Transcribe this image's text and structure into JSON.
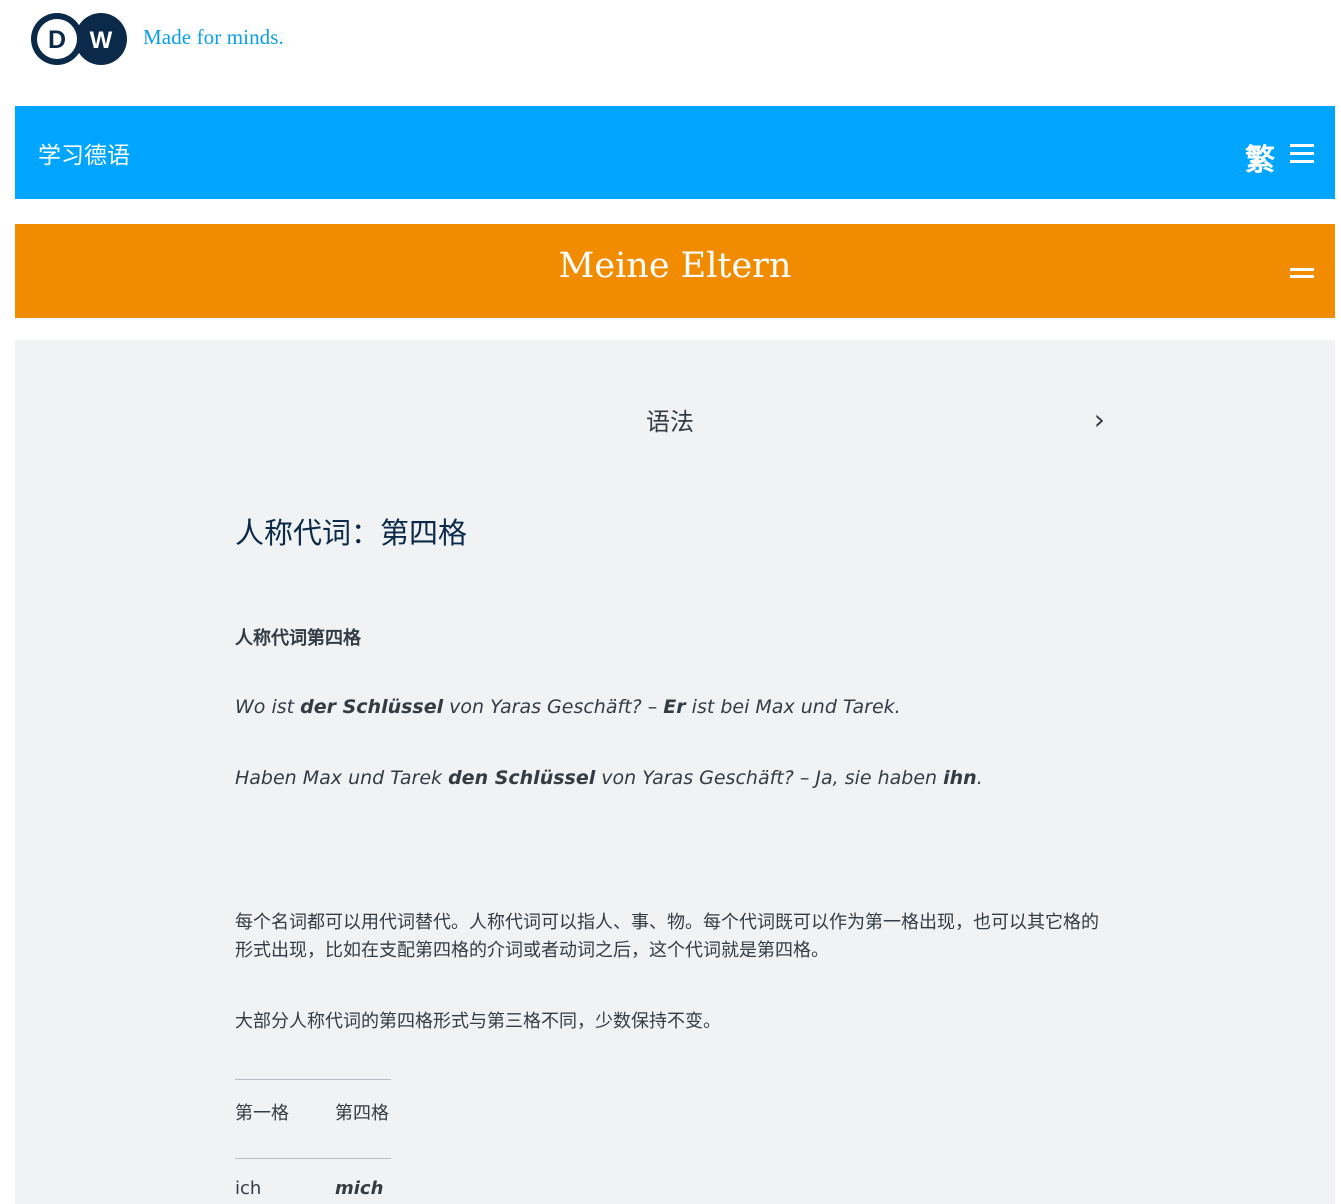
{
  "header": {
    "logo_text": "DW",
    "tagline": "Made for minds."
  },
  "navbar": {
    "title": "学习德语",
    "lang_switch": "繁"
  },
  "lesson": {
    "title": "Meine Eltern"
  },
  "section": {
    "label": "语法",
    "chevron": "›"
  },
  "article": {
    "title": "人称代词：第四格",
    "subheading": "人称代词第四格",
    "example1": {
      "p1": "Wo ist ",
      "b1": "der Schlüssel",
      "p2": " von Yaras Geschäft? – ",
      "b2": "Er",
      "p3": " ist bei Max und Tarek."
    },
    "example2": {
      "p1": "Haben Max und Tarek ",
      "b1": "den Schlüssel",
      "p2": " von Yaras Geschäft? – Ja, sie haben ",
      "b2": "ihn",
      "p3": "."
    },
    "paragraph1": "每个名词都可以用代词替代。人称代词可以指人、事、物。每个代词既可以作为第一格出现，也可以其它格的形式出现，比如在支配第四格的介词或者动词之后，这个代词就是第四格。",
    "paragraph2": "大部分人称代词的第四格形式与第三格不同，少数保持不变。",
    "table": {
      "headers": [
        "第一格",
        "第四格"
      ],
      "rows": [
        [
          "ich",
          "mich"
        ]
      ]
    }
  },
  "colors": {
    "navbar": "#00a5ff",
    "lessonbar": "#f18c00",
    "content_bg": "#f1f2f4",
    "logo_navy": "#0b2a4a",
    "tagline": "#0a9fe6"
  }
}
